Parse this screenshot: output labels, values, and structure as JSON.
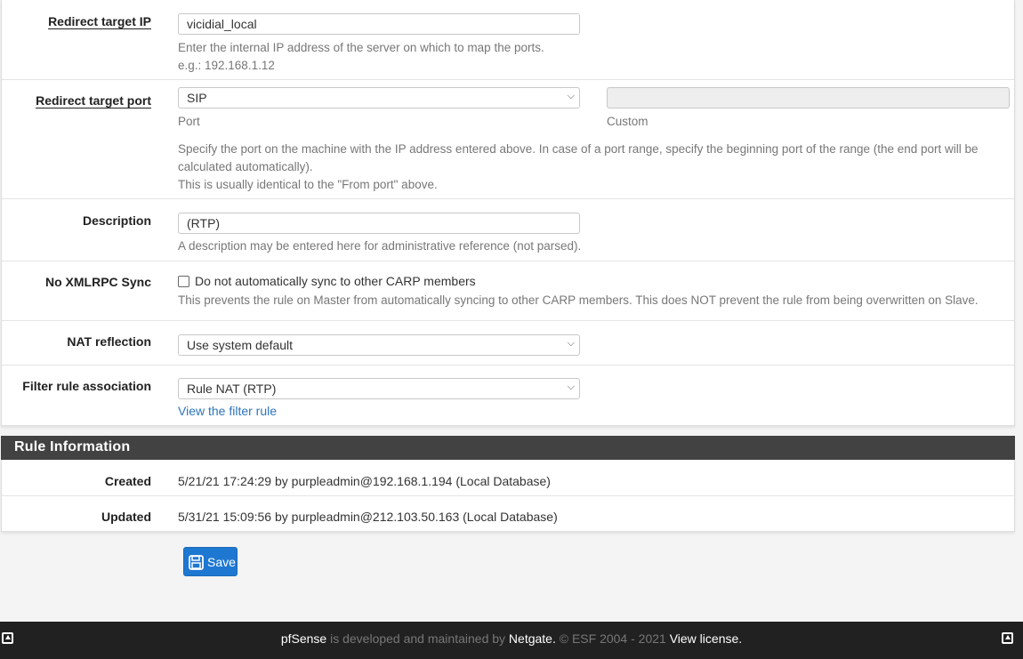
{
  "form": {
    "redirect_ip": {
      "label": "Redirect target IP",
      "value": "vicidial_local",
      "help_line1": "Enter the internal IP address of the server on which to map the ports.",
      "help_line2": "e.g.: 192.168.1.12"
    },
    "redirect_port": {
      "label": "Redirect target port",
      "selected": "SIP",
      "port_label": "Port",
      "custom_value": "",
      "custom_label": "Custom",
      "help_line1": "Specify the port on the machine with the IP address entered above. In case of a port range, specify the beginning port of the range (the end port will be",
      "help_line2": "calculated automatically).",
      "help_line3": "This is usually identical to the \"From port\" above."
    },
    "description": {
      "label": "Description",
      "value": "(RTP)",
      "help": "A description may be entered here for administrative reference (not parsed)."
    },
    "no_xmlrpc": {
      "label": "No XMLRPC Sync",
      "checked": false,
      "checkbox_label": "Do not automatically sync to other CARP members",
      "help": "This prevents the rule on Master from automatically syncing to other CARP members. This does NOT prevent the rule from being overwritten on Slave."
    },
    "nat_reflection": {
      "label": "NAT reflection",
      "selected": "Use system default"
    },
    "filter_rule": {
      "label": "Filter rule association",
      "selected": "Rule NAT (RTP)",
      "link": "View the filter rule"
    }
  },
  "rule_info": {
    "title": "Rule Information",
    "created_label": "Created",
    "created_value": "5/21/21 17:24:29 by purpleadmin@192.168.1.194 (Local Database)",
    "updated_label": "Updated",
    "updated_value": "5/31/21 15:09:56 by purpleadmin@212.103.50.163 (Local Database)"
  },
  "save_label": "Save",
  "footer": {
    "brand": "pfSense",
    "text1": " is developed and maintained by ",
    "company": "Netgate.",
    "text2": " © ESF 2004 - 2021 ",
    "license": "View license."
  },
  "colors": {
    "primary": "#1e78d2",
    "header_bg": "#424242",
    "footer_bg": "#212121",
    "link": "#2d75b9"
  }
}
